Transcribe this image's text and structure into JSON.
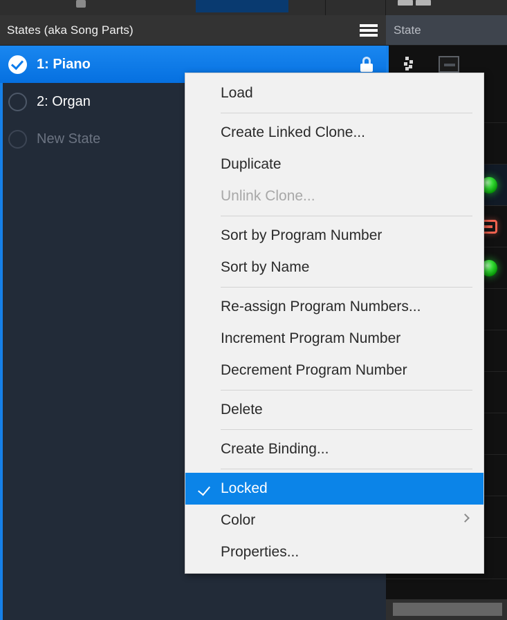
{
  "top_bar": {
    "gear_icon": "gear-icon",
    "blue_tab": "active-tab",
    "pill_icons": [
      "toolbar-pill-1",
      "toolbar-pill-2"
    ]
  },
  "left_panel": {
    "header": {
      "title": "States (aka Song Parts)",
      "menu_icon": "hamburger-menu-icon"
    },
    "states": [
      {
        "label": "1: Piano",
        "selected": true,
        "locked": true,
        "placeholder": false
      },
      {
        "label": "2: Organ",
        "selected": false,
        "locked": false,
        "placeholder": false
      },
      {
        "label": "New State",
        "selected": false,
        "locked": false,
        "placeholder": true
      }
    ]
  },
  "right_panel": {
    "header": {
      "title": "State"
    },
    "toolbar": {
      "scatter_icon": "scatter-dots-icon",
      "collapse_icon": "minus-box-icon"
    },
    "rows": [
      {
        "indicator": "none",
        "style": "plain"
      },
      {
        "indicator": "none",
        "style": "plain"
      },
      {
        "indicator": "green",
        "style": "tinted"
      },
      {
        "indicator": "red-minus",
        "style": "plain"
      },
      {
        "indicator": "green",
        "style": "plain"
      },
      {
        "indicator": "none",
        "style": "plain"
      },
      {
        "indicator": "none",
        "style": "plain"
      },
      {
        "indicator": "none",
        "style": "plain"
      },
      {
        "indicator": "none",
        "style": "plain"
      },
      {
        "indicator": "none",
        "style": "plain"
      },
      {
        "indicator": "none",
        "style": "plain"
      },
      {
        "indicator": "none",
        "style": "plain"
      }
    ]
  },
  "context_menu": {
    "items": [
      {
        "label": "Load",
        "type": "item",
        "disabled": false,
        "checked": false,
        "submenu": false
      },
      {
        "type": "separator"
      },
      {
        "label": "Create Linked Clone...",
        "type": "item",
        "disabled": false,
        "checked": false,
        "submenu": false
      },
      {
        "label": "Duplicate",
        "type": "item",
        "disabled": false,
        "checked": false,
        "submenu": false
      },
      {
        "label": "Unlink Clone...",
        "type": "item",
        "disabled": true,
        "checked": false,
        "submenu": false
      },
      {
        "type": "separator"
      },
      {
        "label": "Sort by Program Number",
        "type": "item",
        "disabled": false,
        "checked": false,
        "submenu": false
      },
      {
        "label": "Sort by Name",
        "type": "item",
        "disabled": false,
        "checked": false,
        "submenu": false
      },
      {
        "type": "separator"
      },
      {
        "label": "Re-assign Program Numbers...",
        "type": "item",
        "disabled": false,
        "checked": false,
        "submenu": false
      },
      {
        "label": "Increment Program Number",
        "type": "item",
        "disabled": false,
        "checked": false,
        "submenu": false
      },
      {
        "label": "Decrement Program Number",
        "type": "item",
        "disabled": false,
        "checked": false,
        "submenu": false
      },
      {
        "type": "separator"
      },
      {
        "label": "Delete",
        "type": "item",
        "disabled": false,
        "checked": false,
        "submenu": false
      },
      {
        "type": "separator"
      },
      {
        "label": "Create Binding...",
        "type": "item",
        "disabled": false,
        "checked": false,
        "submenu": false
      },
      {
        "type": "separator"
      },
      {
        "label": "Locked",
        "type": "item",
        "disabled": false,
        "checked": true,
        "submenu": false,
        "highlighted": true
      },
      {
        "label": "Color",
        "type": "item",
        "disabled": false,
        "checked": false,
        "submenu": true
      },
      {
        "label": "Properties...",
        "type": "item",
        "disabled": false,
        "checked": false,
        "submenu": false
      }
    ]
  },
  "scrollbar": {
    "name": "horizontal-scrollbar"
  },
  "colors": {
    "accent_blue": "#0b7bec",
    "menu_highlight": "#0b84e8",
    "panel_dark": "#222b38",
    "header_dark": "#333333",
    "led_green": "#35dd35",
    "led_red": "#f2624f"
  }
}
